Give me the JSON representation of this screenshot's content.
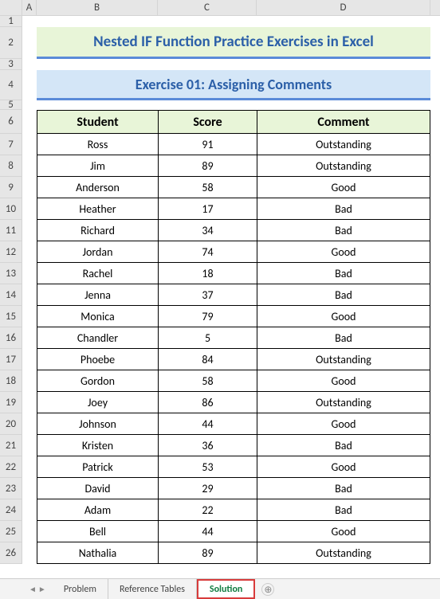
{
  "columns": {
    "a": "A",
    "b": "B",
    "c": "C",
    "d": "D"
  },
  "rows": [
    "1",
    "2",
    "3",
    "4",
    "5",
    "6",
    "7",
    "8",
    "9",
    "10",
    "11",
    "12",
    "13",
    "14",
    "15",
    "16",
    "17",
    "18",
    "19",
    "20",
    "21",
    "22",
    "23",
    "24",
    "25",
    "26"
  ],
  "title": "Nested IF Function Practice Exercises in Excel",
  "subtitle": "Exercise 01: Assigning Comments",
  "headers": {
    "student": "Student",
    "score": "Score",
    "comment": "Comment"
  },
  "chart_data": {
    "type": "table",
    "title": "Exercise 01: Assigning Comments",
    "columns": [
      "Student",
      "Score",
      "Comment"
    ],
    "rows": [
      {
        "student": "Ross",
        "score": 91,
        "comment": "Outstanding"
      },
      {
        "student": "Jim",
        "score": 89,
        "comment": "Outstanding"
      },
      {
        "student": "Anderson",
        "score": 58,
        "comment": "Good"
      },
      {
        "student": "Heather",
        "score": 17,
        "comment": "Bad"
      },
      {
        "student": "Richard",
        "score": 34,
        "comment": "Bad"
      },
      {
        "student": "Jordan",
        "score": 74,
        "comment": "Good"
      },
      {
        "student": "Rachel",
        "score": 18,
        "comment": "Bad"
      },
      {
        "student": "Jenna",
        "score": 37,
        "comment": "Bad"
      },
      {
        "student": "Monica",
        "score": 79,
        "comment": "Good"
      },
      {
        "student": "Chandler",
        "score": 5,
        "comment": "Bad"
      },
      {
        "student": "Phoebe",
        "score": 84,
        "comment": "Outstanding"
      },
      {
        "student": "Gordon",
        "score": 58,
        "comment": "Good"
      },
      {
        "student": "Joey",
        "score": 86,
        "comment": "Outstanding"
      },
      {
        "student": "Johnson",
        "score": 44,
        "comment": "Good"
      },
      {
        "student": "Kristen",
        "score": 36,
        "comment": "Bad"
      },
      {
        "student": "Patrick",
        "score": 53,
        "comment": "Good"
      },
      {
        "student": "David",
        "score": 29,
        "comment": "Bad"
      },
      {
        "student": "Adam",
        "score": 22,
        "comment": "Bad"
      },
      {
        "student": "Bell",
        "score": 44,
        "comment": "Good"
      },
      {
        "student": "Nathalia",
        "score": 89,
        "comment": "Outstanding"
      }
    ]
  },
  "tabs": {
    "problem": "Problem",
    "reference": "Reference Tables",
    "solution": "Solution"
  },
  "nav": {
    "prev": "◄",
    "next": "►"
  },
  "add": "⊕"
}
